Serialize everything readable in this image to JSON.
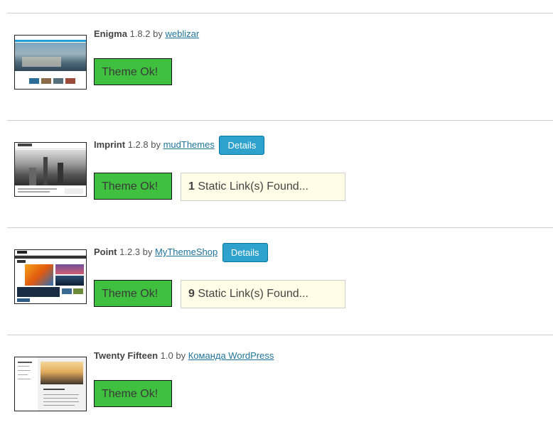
{
  "themes": [
    {
      "name": "Enigma",
      "version": "1.8.2",
      "by": "by",
      "author": "weblizar",
      "status": "Theme Ok!"
    },
    {
      "name": "Imprint",
      "version": "1.2.8",
      "by": "by",
      "author": "mudThemes",
      "details": "Details",
      "status": "Theme Ok!",
      "static_count": "1",
      "static_text": "Static Link(s) Found..."
    },
    {
      "name": "Point",
      "version": "1.2.3",
      "by": "by",
      "author": "MyThemeShop",
      "details": "Details",
      "status": "Theme Ok!",
      "static_count": "9",
      "static_text": "Static Link(s) Found..."
    },
    {
      "name": "Twenty Fifteen",
      "version": "1.0",
      "by": "by",
      "author": "Команда WordPress",
      "status": "Theme Ok!"
    }
  ],
  "colors": {
    "ok_green": "#3fc03f",
    "details_blue": "#2ea2cc",
    "warning_bg": "#fffde6",
    "link": "#21759b"
  }
}
